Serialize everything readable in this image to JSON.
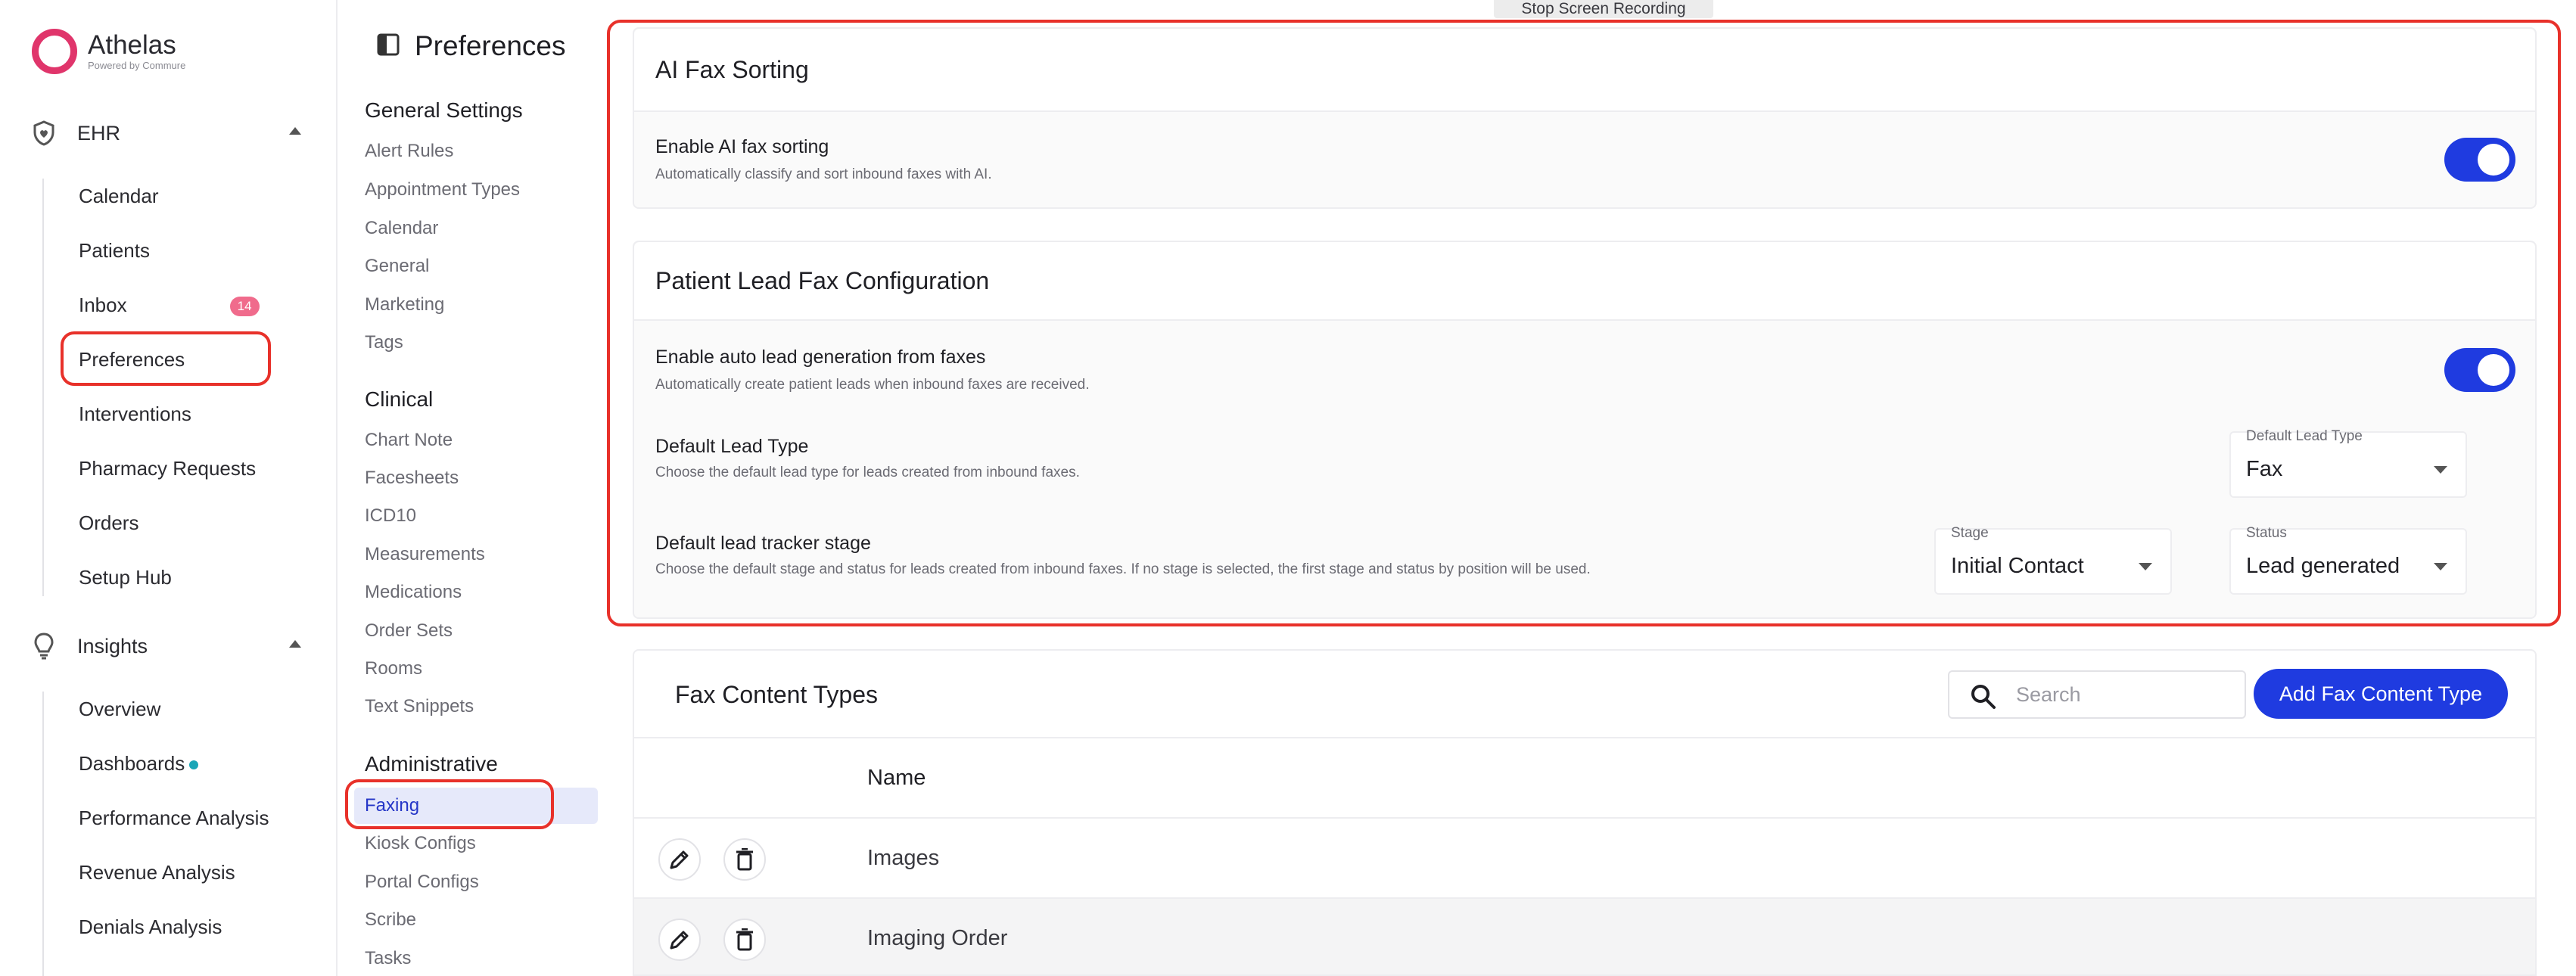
{
  "window": {
    "recording_label": "Stop Screen Recording"
  },
  "brand": {
    "name": "Athelas",
    "tagline": "Powered by Commure"
  },
  "nav": {
    "groups": [
      {
        "label": "EHR",
        "icon": "shield-heart-icon",
        "items": [
          {
            "label": "Calendar"
          },
          {
            "label": "Patients"
          },
          {
            "label": "Inbox",
            "badge": "14"
          },
          {
            "label": "Preferences"
          },
          {
            "label": "Interventions"
          },
          {
            "label": "Pharmacy Requests"
          },
          {
            "label": "Orders"
          },
          {
            "label": "Setup Hub"
          }
        ]
      },
      {
        "label": "Insights",
        "icon": "lightbulb-icon",
        "items": [
          {
            "label": "Overview"
          },
          {
            "label": "Dashboards"
          },
          {
            "label": "Performance Analysis"
          },
          {
            "label": "Revenue Analysis"
          },
          {
            "label": "Denials Analysis"
          }
        ]
      }
    ]
  },
  "preferences": {
    "title": "Preferences",
    "sections": [
      {
        "heading": "General Settings",
        "items": [
          "Alert Rules",
          "Appointment Types",
          "Calendar",
          "General",
          "Marketing",
          "Tags"
        ]
      },
      {
        "heading": "Clinical",
        "items": [
          "Chart Note",
          "Facesheets",
          "ICD10",
          "Measurements",
          "Medications",
          "Order Sets",
          "Rooms",
          "Text Snippets"
        ]
      },
      {
        "heading": "Administrative",
        "items": [
          "Faxing",
          "Kiosk Configs",
          "Portal Configs",
          "Scribe",
          "Tasks"
        ]
      }
    ],
    "active_item": "Faxing"
  },
  "ai_fax": {
    "title": "AI Fax Sorting",
    "enable_title": "Enable AI fax sorting",
    "enable_desc": "Automatically classify and sort inbound faxes with AI.",
    "enabled": true
  },
  "lead_config": {
    "title": "Patient Lead Fax Configuration",
    "auto_title": "Enable auto lead generation from faxes",
    "auto_desc": "Automatically create patient leads when inbound faxes are received.",
    "auto_enabled": true,
    "lead_type_title": "Default Lead Type",
    "lead_type_desc": "Choose the default lead type for leads created from inbound faxes.",
    "lead_type_label": "Default Lead Type",
    "lead_type_value": "Fax",
    "stage_title": "Default lead tracker stage",
    "stage_desc": "Choose the default stage and status for leads created from inbound faxes. If no stage is selected, the first stage and status by position will be used.",
    "stage_label": "Stage",
    "stage_value": "Initial Contact",
    "status_label": "Status",
    "status_value": "Lead generated"
  },
  "fax_types": {
    "title": "Fax Content Types",
    "search_placeholder": "Search",
    "add_label": "Add Fax Content Type",
    "column_name": "Name",
    "rows": [
      {
        "name": "Images"
      },
      {
        "name": "Imaging Order"
      }
    ]
  },
  "colors": {
    "accent": "#1f3be0",
    "brand": "#e0356b",
    "highlight": "#e8312a",
    "active_bg": "#e6e9fa"
  }
}
